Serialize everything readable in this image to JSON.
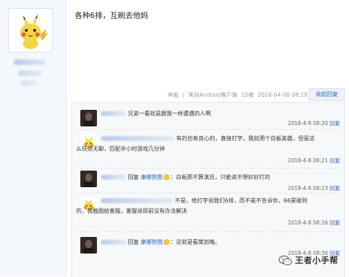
{
  "post": {
    "text": "各种6排，互刷去他妈"
  },
  "post_meta": {
    "report": "举报",
    "separator": "|",
    "source": "来自Android客户端",
    "floor": "15楼",
    "time": "2018-04-08 08:19",
    "collapse_label": "收起回复"
  },
  "replies": [
    {
      "reply_to": "",
      "content": "兄弟一看就是跟我一样遭遇的人啊",
      "time": "2018-4-8 08:20",
      "reply_label": "回复"
    },
    {
      "reply_to": "",
      "content_line1": "有的也有良心的，直接打字，我就用个白板英雄，但是这",
      "content_line2": "么玩很无聊，匹配半小时游戏几分钟",
      "time": "2018-4-8 08:21",
      "reply_label": "回复"
    },
    {
      "reply_prefix": "回复",
      "reply_to": "康娜抱我",
      "content": "：白板那不算演员，只能说不想好好打的",
      "time": "2018-4-8 08:23",
      "reply_label": "回复"
    },
    {
      "reply_to": "",
      "content_line1": "不是，他打字说我们6排，而不是不告诉你，66星碰到",
      "content_line2": "的，我截图给客服，客服说目前没有办法解决",
      "time": "2018-4-8 08:26",
      "reply_label": "回复"
    },
    {
      "reply_prefix": "回复",
      "reply_to": "康娜抱我",
      "content": "：这就是看策划咯。",
      "time": "2018-4-8 08:30",
      "reply_label": "回复"
    }
  ],
  "watermark": {
    "text": "王者小手帮"
  },
  "colors": {
    "link": "#2d64b3",
    "sidebar_bg": "#f4f7fb",
    "reply_bg": "#f7f8fa"
  }
}
